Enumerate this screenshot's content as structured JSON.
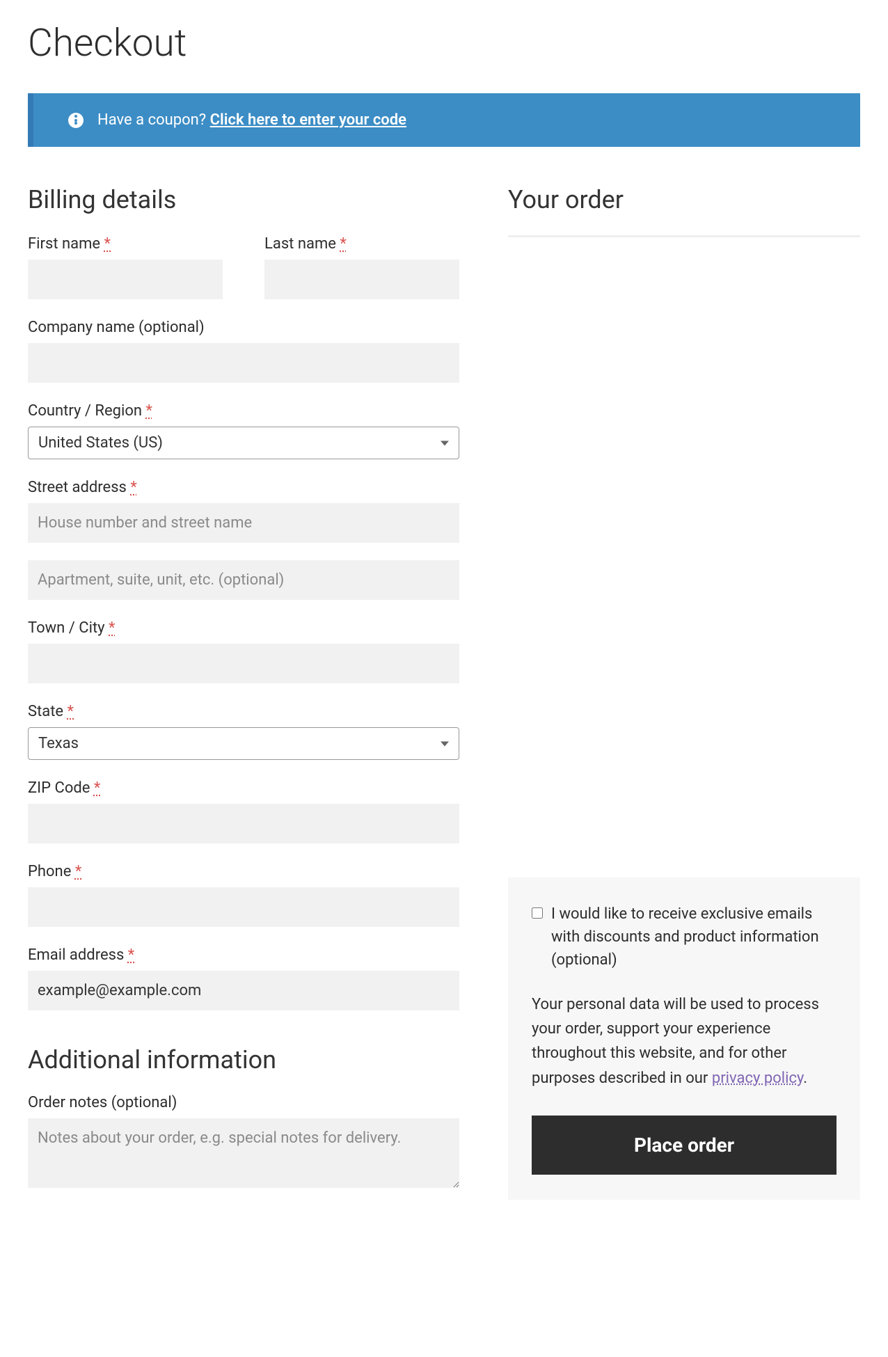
{
  "page_title": "Checkout",
  "coupon_notice": {
    "text": "Have a coupon? ",
    "link_text": "Click here to enter your code"
  },
  "billing": {
    "heading": "Billing details",
    "first_name_label": "First name ",
    "last_name_label": "Last name ",
    "company_label": "Company name (optional)",
    "country_label": "Country / Region ",
    "country_value": "United States (US)",
    "street_label": "Street address ",
    "street_placeholder": "House number and street name",
    "street2_placeholder": "Apartment, suite, unit, etc. (optional)",
    "city_label": "Town / City ",
    "state_label": "State ",
    "state_value": "Texas",
    "zip_label": "ZIP Code ",
    "phone_label": "Phone ",
    "email_label": "Email address ",
    "email_value": "example@example.com",
    "required_mark": "*"
  },
  "additional": {
    "heading": "Additional information",
    "notes_label": "Order notes (optional)",
    "notes_placeholder": "Notes about your order, e.g. special notes for delivery."
  },
  "order": {
    "heading": "Your order",
    "optin_label": "I would like to receive exclusive emails with discounts and product information (optional)",
    "privacy_text_prefix": "Your personal data will be used to process your order, support your experience throughout this website, and for other purposes described in our ",
    "privacy_link": "privacy policy",
    "privacy_text_suffix": ".",
    "place_order_label": "Place order"
  }
}
